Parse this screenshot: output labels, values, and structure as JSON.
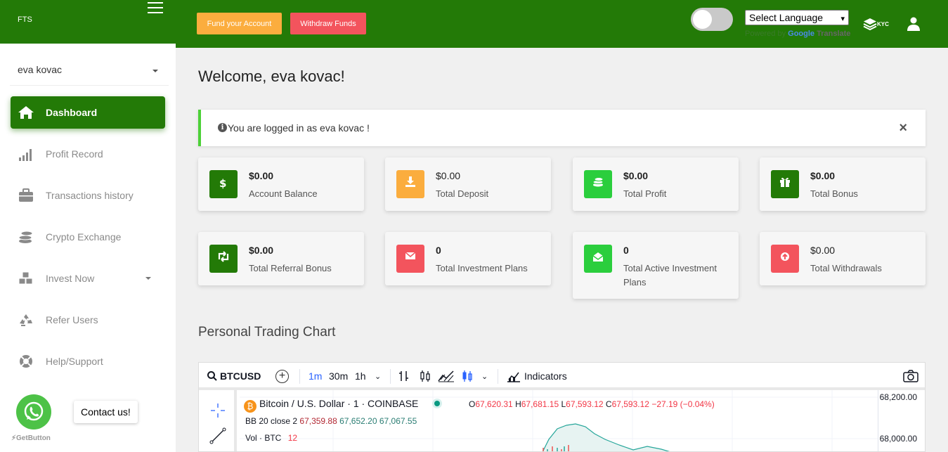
{
  "brand": {
    "name": "FTS"
  },
  "header": {
    "fund_label": "Fund your Account",
    "withdraw_label": "Withdraw Funds",
    "language_select": "Select Language",
    "powered_by": "Powered by",
    "translate_brand": "Google",
    "translate_word": "Translate",
    "kyc_label": "KYC"
  },
  "sidebar": {
    "user_name": "eva kovac",
    "items": [
      {
        "label": "Dashboard",
        "icon": "home-icon",
        "active": true
      },
      {
        "label": "Profit Record",
        "icon": "bar-chart-icon"
      },
      {
        "label": "Transactions history",
        "icon": "briefcase-icon"
      },
      {
        "label": "Crypto Exchange",
        "icon": "coins-icon"
      },
      {
        "label": "Invest Now",
        "icon": "cubes-icon",
        "has_dropdown": true
      },
      {
        "label": "Refer Users",
        "icon": "recycle-icon"
      },
      {
        "label": "Help/Support",
        "icon": "life-ring-icon"
      }
    ]
  },
  "contact": {
    "tooltip": "Contact us!",
    "getbutton": "GetButton"
  },
  "main": {
    "welcome": "Welcome, eva kovac!",
    "alert": "You are logged in as eva kovac !",
    "alert_close": "×",
    "cards": [
      {
        "value": "$0.00",
        "label": "Account Balance",
        "color": "#237a07",
        "icon": "dollar-icon"
      },
      {
        "value": "$0.00",
        "label": "Total Deposit",
        "color": "#fbad3e",
        "icon": "download-icon"
      },
      {
        "value": "$0.00",
        "label": "Total Profit",
        "color": "#2bce3d",
        "icon": "coins-icon"
      },
      {
        "value": "$0.00",
        "label": "Total Bonus",
        "color": "#237a07",
        "icon": "gift-icon"
      },
      {
        "value": "$0.00",
        "label": "Total Referral Bonus",
        "color": "#237a07",
        "icon": "retweet-icon"
      },
      {
        "value": "0",
        "label": "Total Investment Plans",
        "color": "#f3545d",
        "icon": "envelope-icon"
      },
      {
        "value": "0",
        "label": "Total Active Investment Plans",
        "color": "#2bce3d",
        "icon": "envelope-open-icon"
      },
      {
        "value": "$0.00",
        "label": "Total Withdrawals",
        "color": "#f3545d",
        "icon": "arrow-up-icon"
      }
    ],
    "chart_section_title": "Personal Trading Chart"
  },
  "trading": {
    "symbol": "BTCUSD",
    "intervals": [
      "1m",
      "30m",
      "1h"
    ],
    "active_interval": "1m",
    "indicators_label": "Indicators",
    "title": "Bitcoin / U.S. Dollar · 1 · COINBASE",
    "ohlc": {
      "o_label": "O",
      "o": "67,620.31",
      "h_label": "H",
      "h": "67,681.15",
      "l_label": "L",
      "l": "67,593.12",
      "c_label": "C",
      "c": "67,593.12",
      "change": "−27.19 (−0.04%)"
    },
    "bb_label": "BB 20 close 2",
    "bb_values": [
      "67,359.88",
      "67,652.20",
      "67,067.55"
    ],
    "vol_label": "Vol · BTC",
    "vol_value": "12",
    "price_ticks": [
      "68,200.00",
      "68,000.00"
    ]
  }
}
